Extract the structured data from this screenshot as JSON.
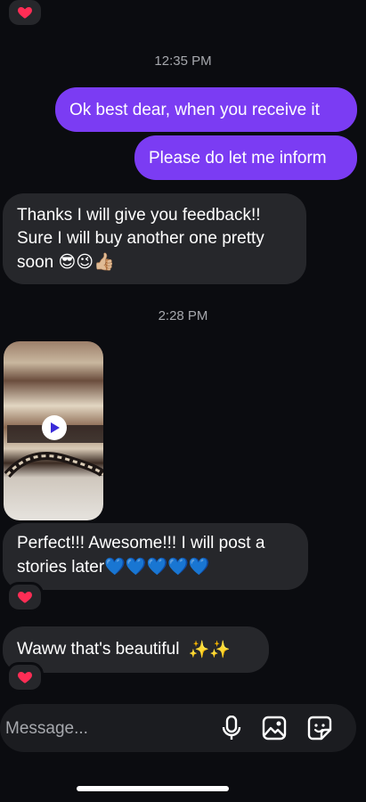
{
  "conversation": {
    "timestamp_1": "12:35 PM",
    "sent_1": "Ok best dear, when you receive it",
    "sent_2": "Please do let me inform",
    "received_1_line1": "Thanks I will give you feedback!!",
    "received_1_line2": "Sure I will buy another one pretty",
    "received_1_line3": "soon",
    "received_1_emojis": "😎😉👍🏼",
    "timestamp_2": "2:28 PM",
    "received_2_line1": "Perfect!!! Awesome!!! I will post a",
    "received_2_line2": "stories later",
    "received_2_emojis": "💙💙💙💙💙",
    "received_3": "Waww that's beautiful",
    "received_3_emojis": "✨✨"
  },
  "reaction_icon": "heart-icon",
  "colors": {
    "sent_bubble": "#7b3cf3",
    "received_bubble": "#26272b",
    "background": "#0b0c10",
    "reaction_heart": "#ff2d55"
  },
  "composer": {
    "placeholder": "Message...",
    "icons": [
      "microphone-icon",
      "gallery-icon",
      "sticker-icon"
    ]
  }
}
